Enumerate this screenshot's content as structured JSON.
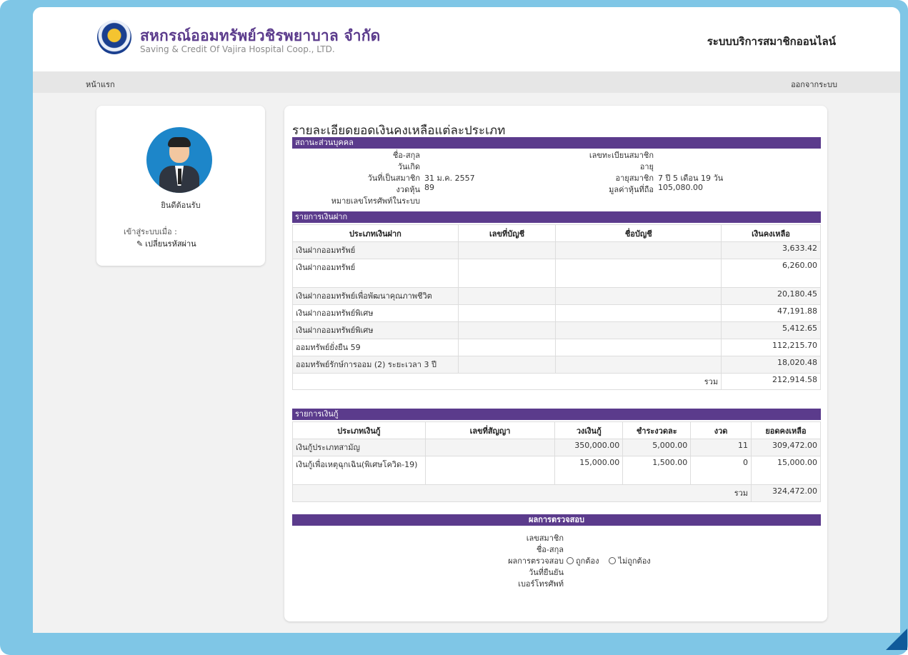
{
  "header": {
    "org_name_th": "สหกรณ์ออมทรัพย์วชิรพยาบาล จำกัด",
    "org_name_en": "Saving & Credit Of Vajira Hospital Coop., LTD.",
    "system_title": "ระบบบริการสมาชิกออนไลน์"
  },
  "nav": {
    "home": "หน้าแรก",
    "logout": "ออกจากระบบ"
  },
  "sidebar": {
    "welcome": "ยินดีต้อนรับ",
    "login_label": "เข้าสู่ระบบเมื่อ :",
    "change_password": "เปลี่ยนรหัสผ่าน"
  },
  "main": {
    "title": "รายละเอียดยอดเงินคงเหลือแต่ละประเภท",
    "personal": {
      "section": "สถานะส่วนบุคคล",
      "name_label": "ชื่อ-สกุล",
      "birth_label": "วันเกิด",
      "join_label": "วันที่เป็นสมาชิก",
      "join_value": "31 ม.ค. 2557",
      "share_label": "งวดหุ้น",
      "share_value": "89",
      "phone_label": "หมายเลขโทรศัพท์ในระบบ",
      "member_no_label": "เลขทะเบียนสมาชิก",
      "age_label": "อายุ",
      "member_age_label": "อายุสมาชิก",
      "member_age_value": "7 ปี 5 เดือน 19 วัน",
      "share_value_label": "มูลค่าหุ้นที่ถือ",
      "share_value_amount": "105,080.00"
    },
    "deposits": {
      "section": "รายการเงินฝาก",
      "headers": [
        "ประเภทเงินฝาก",
        "เลขที่บัญชี",
        "ชื่อบัญชี",
        "เงินคงเหลือ"
      ],
      "rows": [
        {
          "type": "เงินฝากออมทรัพย์",
          "balance": "3,633.42"
        },
        {
          "type": "เงินฝากออมทรัพย์",
          "balance": "6,260.00"
        },
        {
          "type": "เงินฝากออมทรัพย์เพื่อพัฒนาคุณภาพชีวิต",
          "balance": "20,180.45"
        },
        {
          "type": "เงินฝากออมทรัพย์พิเศษ",
          "balance": "47,191.88"
        },
        {
          "type": "เงินฝากออมทรัพย์พิเศษ",
          "balance": "5,412.65"
        },
        {
          "type": "ออมทรัพย์ยั่งยืน 59",
          "balance": "112,215.70"
        },
        {
          "type": "ออมทรัพย์รักษ์การออม (2) ระยะเวลา 3 ปี",
          "balance": "18,020.48"
        }
      ],
      "total_label": "รวม",
      "total": "212,914.58"
    },
    "loans": {
      "section": "รายการเงินกู้",
      "headers": [
        "ประเภทเงินกู้",
        "เลขที่สัญญา",
        "วงเงินกู้",
        "ชำระงวดละ",
        "งวด",
        "ยอดคงเหลือ"
      ],
      "rows": [
        {
          "type": "เงินกู้ประเภทสามัญ",
          "limit": "350,000.00",
          "installment": "5,000.00",
          "period": "11",
          "balance": "309,472.00"
        },
        {
          "type": "เงินกู้เพื่อเหตุฉุกเฉิน(พิเศษโควิด-19)",
          "limit": "15,000.00",
          "installment": "1,500.00",
          "period": "0",
          "balance": "15,000.00"
        }
      ],
      "total_label": "รวม",
      "total": "324,472.00"
    },
    "verification": {
      "section": "ผลการตรวจสอบ",
      "member_no_label": "เลขสมาชิก",
      "name_label": "ชื่อ-สกุล",
      "result_label": "ผลการตรวจสอบ",
      "option_correct": "ถูกต้อง",
      "option_incorrect": "ไม่ถูกต้อง",
      "confirm_date_label": "วันที่ยืนยัน",
      "phone_label": "เบอร์โทรศัพท์"
    }
  }
}
